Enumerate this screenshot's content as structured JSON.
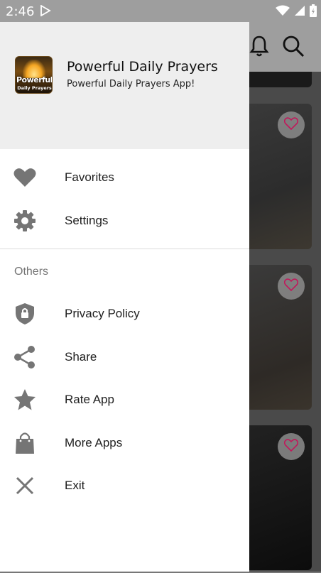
{
  "status_bar": {
    "time": "2:46",
    "icons": [
      "play-store-icon",
      "wifi-icon",
      "signal-icon",
      "battery-icon"
    ]
  },
  "background_app": {
    "toolbar_icons": [
      "bell-icon",
      "search-icon"
    ],
    "cards": [
      {
        "favorite_icon": "heart-outline-icon"
      },
      {
        "favorite_icon": "heart-outline-icon"
      },
      {
        "favorite_icon": "heart-outline-icon"
      }
    ]
  },
  "drawer": {
    "header": {
      "logo_text_line1": "Powerful",
      "logo_text_line2": "Daily Prayers",
      "title": "Powerful Daily Prayers",
      "subtitle": "Powerful Daily Prayers App!"
    },
    "main_items": [
      {
        "label": "Favorites",
        "icon": "heart-icon"
      },
      {
        "label": "Settings",
        "icon": "gear-icon"
      }
    ],
    "section_title": "Others",
    "other_items": [
      {
        "label": "Privacy Policy",
        "icon": "shield-lock-icon"
      },
      {
        "label": "Share",
        "icon": "share-icon"
      },
      {
        "label": "Rate App",
        "icon": "star-icon"
      },
      {
        "label": "More Apps",
        "icon": "shopping-bag-icon"
      },
      {
        "label": "Exit",
        "icon": "close-icon"
      }
    ]
  },
  "colors": {
    "icon_gray": "#757575",
    "header_bg": "#eeeeee",
    "scrim": "#4a4a4a",
    "heart_accent": "#c2185b"
  }
}
